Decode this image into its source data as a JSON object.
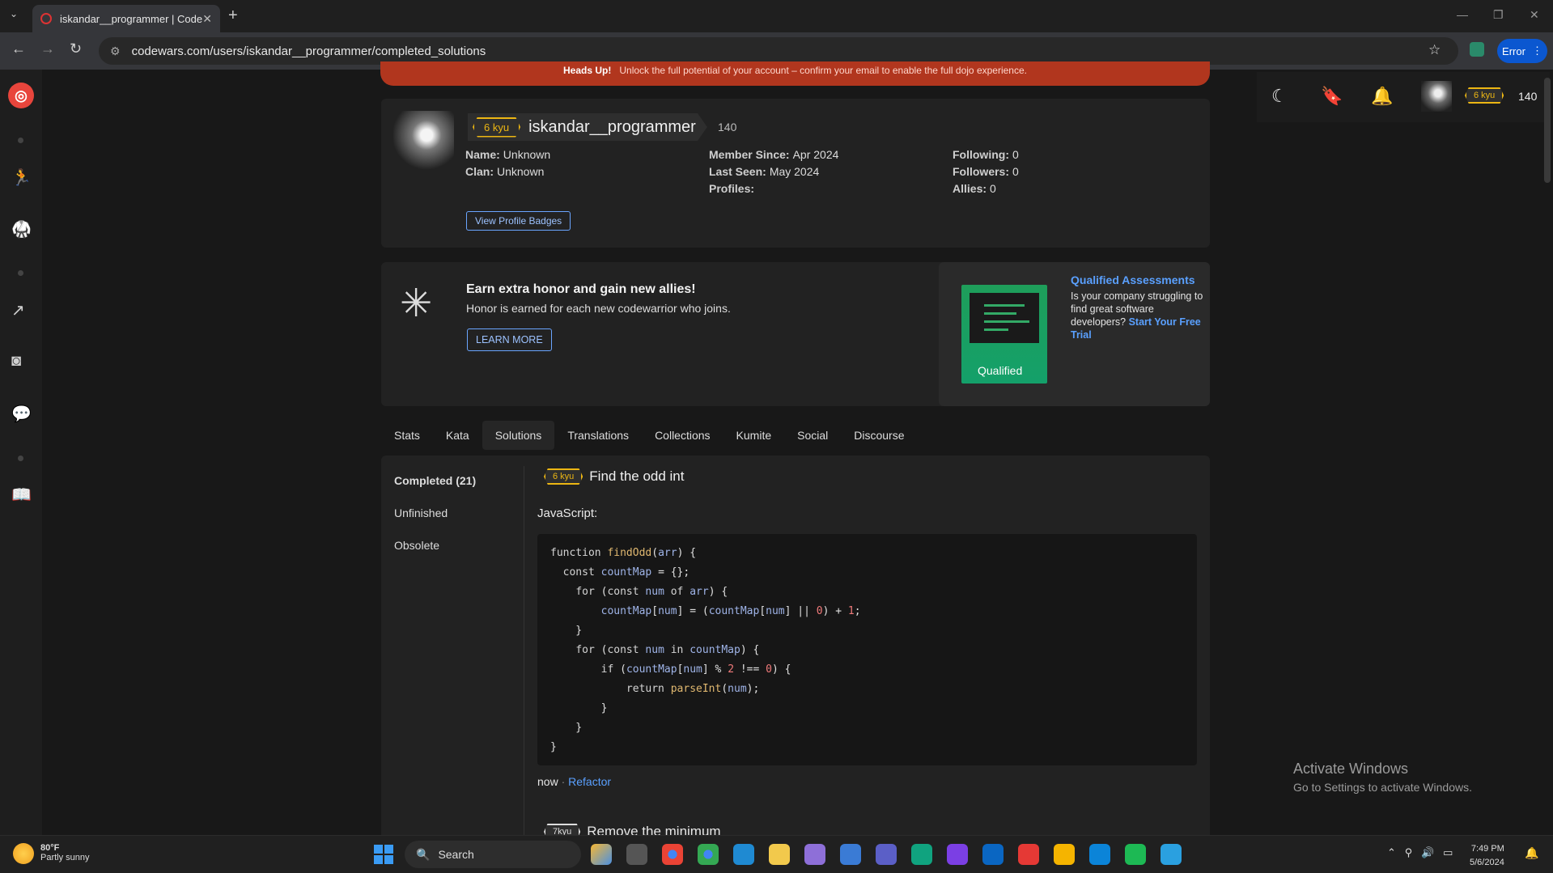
{
  "browser": {
    "tab_title": "iskandar__programmer | Codew",
    "url": "codewars.com/users/iskandar__programmer/completed_solutions",
    "error_button": "Error"
  },
  "banner": {
    "label": "Heads Up!",
    "text": "Unlock the full potential of your account – confirm your email to enable the full dojo experience."
  },
  "profile": {
    "rank": "6 kyu",
    "username": "iskandar__programmer",
    "honor": "140",
    "name_label": "Name:",
    "name": "Unknown",
    "clan_label": "Clan:",
    "clan": "Unknown",
    "member_since_label": "Member Since:",
    "member_since": "Apr 2024",
    "last_seen_label": "Last Seen:",
    "last_seen": "May 2024",
    "profiles_label": "Profiles:",
    "following_label": "Following:",
    "following": "0",
    "followers_label": "Followers:",
    "followers": "0",
    "allies_label": "Allies:",
    "allies": "0",
    "badges_button": "View Profile Badges"
  },
  "promo": {
    "title": "Earn extra honor and gain new allies!",
    "text": "Honor is earned for each new codewarrior who joins.",
    "button": "LEARN MORE"
  },
  "qualified": {
    "image_label": "Qualified",
    "title": "Qualified Assessments",
    "text": "Is your company struggling to find great software developers?",
    "link": "Start Your Free Trial"
  },
  "tabs": [
    "Stats",
    "Kata",
    "Solutions",
    "Translations",
    "Collections",
    "Kumite",
    "Social",
    "Discourse"
  ],
  "subnav": [
    "Completed (21)",
    "Unfinished",
    "Obsolete"
  ],
  "solution": {
    "rank": "6 kyu",
    "kata_name": "Find the odd int",
    "language": "JavaScript:",
    "time": "now",
    "separator": "·",
    "refactor": "Refactor"
  },
  "next_solution": {
    "rank": "7kyu",
    "kata_name": "Remove the minimum"
  },
  "topbar": {
    "rank": "6 kyu",
    "honor": "140"
  },
  "watermark": {
    "line1": "Activate Windows",
    "line2": "Go to Settings to activate Windows."
  },
  "taskbar": {
    "temp": "80°F",
    "weather": "Partly sunny",
    "search": "Search",
    "time": "7:49 PM",
    "date": "5/6/2024"
  },
  "colors": {
    "accent": "#e8453c",
    "rank": "#ecb613",
    "link": "#5aa0ff"
  }
}
